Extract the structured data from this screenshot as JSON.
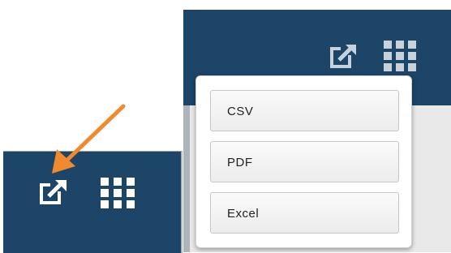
{
  "colors": {
    "toolbar_bg": "#1c4568",
    "icon": "#ffffff",
    "icon_muted": "#c9d2da",
    "arrow": "#f08a2c",
    "menu_bg": "#ffffff"
  },
  "toolbar": {
    "export_icon": "export-icon",
    "grid_icon": "grid-menu-icon"
  },
  "export_menu": {
    "items": [
      {
        "label": "CSV"
      },
      {
        "label": "PDF"
      },
      {
        "label": "Excel"
      }
    ]
  }
}
